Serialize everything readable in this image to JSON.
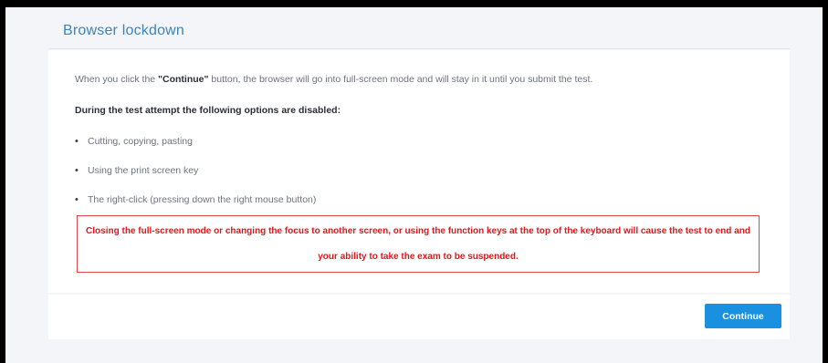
{
  "dialog": {
    "title": "Browser lockdown",
    "intro_prefix": "When you click the ",
    "intro_highlight": "\"Continue\"",
    "intro_suffix": " button, the browser will go into full-screen mode and will stay in it until you submit the test.",
    "subheading": "During the test attempt the following options are disabled:",
    "disabled_options": [
      "Cutting, copying, pasting",
      "Using the print screen key",
      "The right-click (pressing down the right mouse button)"
    ],
    "warning": "Closing the full-screen mode or changing the focus to another screen, or using the function keys at the top of the keyboard will cause the test to end and your ability to take the exam to be suspended.",
    "bullet_glyph": "•"
  },
  "footer": {
    "continue_label": "Continue"
  },
  "colors": {
    "title": "#3d83b7",
    "warning": "#e8141c",
    "button": "#1990e0"
  }
}
